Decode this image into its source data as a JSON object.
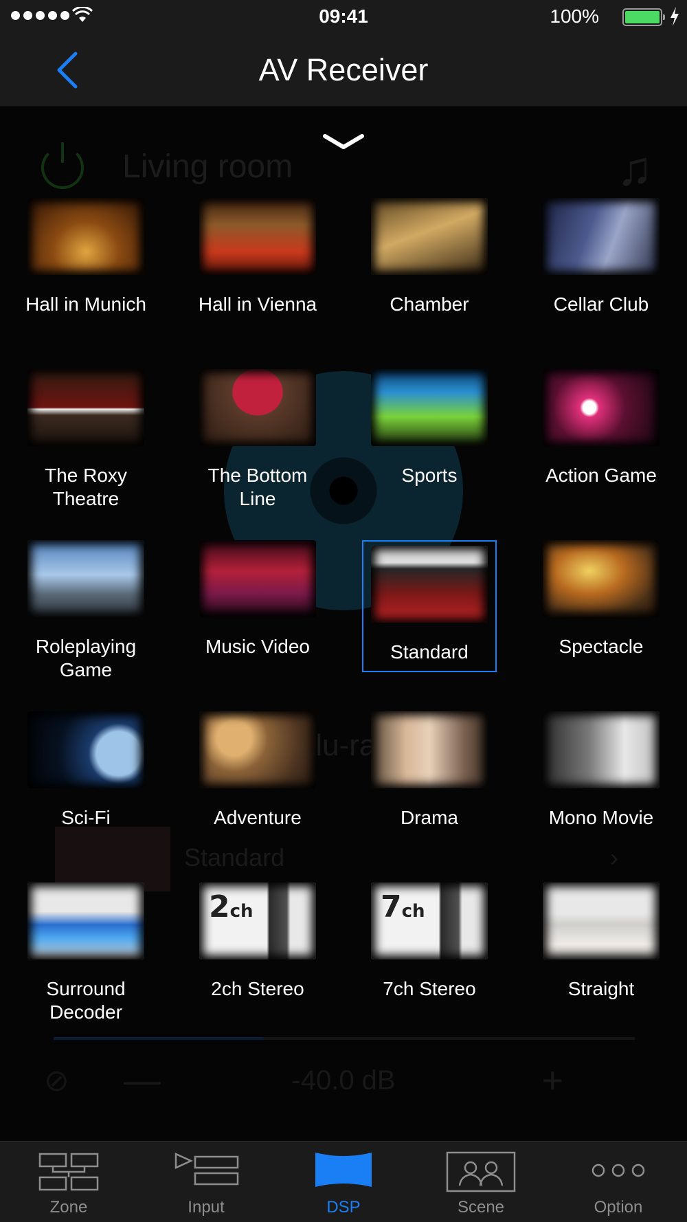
{
  "status_bar": {
    "time": "09:41",
    "battery": "100%"
  },
  "nav": {
    "title": "AV Receiver"
  },
  "background": {
    "room": "Living room",
    "input": "Blu-ray",
    "sound_program": "Standard",
    "volume": "-40.0 dB",
    "minus": "—",
    "plus": "+"
  },
  "dsp_programs": [
    {
      "label": "Hall in Munich"
    },
    {
      "label": "Hall in Vienna"
    },
    {
      "label": "Chamber"
    },
    {
      "label": "Cellar Club"
    },
    {
      "label": "The Roxy\nTheatre"
    },
    {
      "label": "The Bottom\nLine"
    },
    {
      "label": "Sports"
    },
    {
      "label": "Action Game"
    },
    {
      "label": "Roleplaying\nGame"
    },
    {
      "label": "Music Video"
    },
    {
      "label": "Standard",
      "selected": true
    },
    {
      "label": "Spectacle"
    },
    {
      "label": "Sci-Fi"
    },
    {
      "label": "Adventure"
    },
    {
      "label": "Drama"
    },
    {
      "label": "Mono Movie"
    },
    {
      "label": "Surround\nDecoder"
    },
    {
      "label": "2ch Stereo"
    },
    {
      "label": "7ch Stereo"
    },
    {
      "label": "Straight"
    }
  ],
  "thumb_text": {
    "two_ch_num": "2",
    "seven_ch_num": "7",
    "ch_unit": "ch"
  },
  "tabs": [
    {
      "label": "Zone"
    },
    {
      "label": "Input"
    },
    {
      "label": "DSP",
      "active": true
    },
    {
      "label": "Scene"
    },
    {
      "label": "Option"
    }
  ],
  "colors": {
    "accent": "#1a7ef5",
    "battery": "#4cd964",
    "bar_bg": "#1b1b1b"
  }
}
